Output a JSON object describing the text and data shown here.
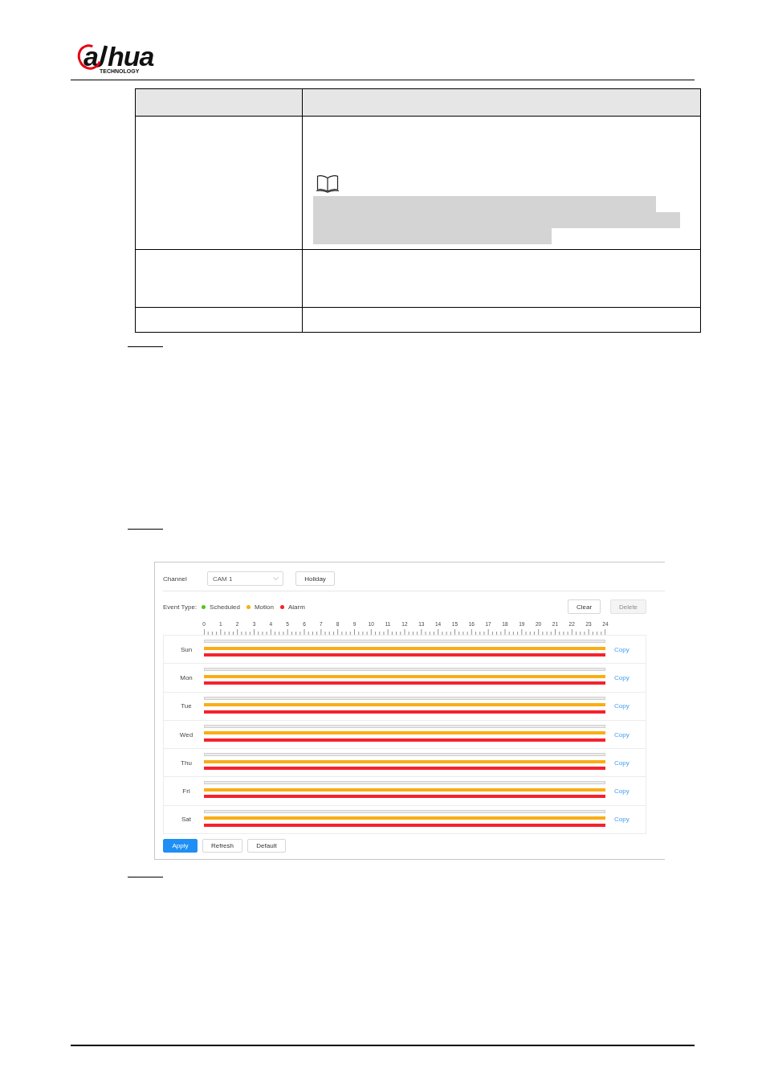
{
  "logo": {
    "mark": "a",
    "name": "hua",
    "tagline": "TECHNOLOGY"
  },
  "table": {
    "rows": [
      {
        "kind": "header"
      },
      {
        "kind": "note",
        "note": {
          "lines": [
            {
              "kind": "redacted"
            },
            {
              "kind": "redacted"
            },
            {
              "kind": "redacted"
            }
          ]
        }
      },
      {
        "kind": "blank"
      },
      {
        "kind": "blank"
      }
    ]
  },
  "schedule": {
    "channel": {
      "label": "Channel",
      "value": "CAM 1"
    },
    "holiday_button": "Holiday",
    "event_type_label": "Event Type:",
    "event_types": [
      {
        "name": "Scheduled",
        "color": "#52c41a"
      },
      {
        "name": "Motion",
        "color": "#faad14"
      },
      {
        "name": "Alarm",
        "color": "#f5222d"
      }
    ],
    "clear_button": "Clear",
    "delete_button": {
      "label": "Delete",
      "disabled": true
    },
    "hours": [
      "0",
      "1",
      "2",
      "3",
      "4",
      "5",
      "6",
      "7",
      "8",
      "9",
      "10",
      "11",
      "12",
      "13",
      "14",
      "15",
      "16",
      "17",
      "18",
      "19",
      "20",
      "21",
      "22",
      "23",
      "24"
    ],
    "days": [
      {
        "name": "Sun",
        "tracks": [
          {
            "filled": false
          },
          {
            "filled": true
          },
          {
            "filled": true
          }
        ],
        "copy": "Copy"
      },
      {
        "name": "Mon",
        "tracks": [
          {
            "filled": false
          },
          {
            "filled": true
          },
          {
            "filled": true
          }
        ],
        "copy": "Copy"
      },
      {
        "name": "Tue",
        "tracks": [
          {
            "filled": false
          },
          {
            "filled": true
          },
          {
            "filled": true
          }
        ],
        "copy": "Copy"
      },
      {
        "name": "Wed",
        "tracks": [
          {
            "filled": false
          },
          {
            "filled": true
          },
          {
            "filled": true
          }
        ],
        "copy": "Copy"
      },
      {
        "name": "Thu",
        "tracks": [
          {
            "filled": false
          },
          {
            "filled": true
          },
          {
            "filled": true
          }
        ],
        "copy": "Copy"
      },
      {
        "name": "Fri",
        "tracks": [
          {
            "filled": false
          },
          {
            "filled": true
          },
          {
            "filled": true
          }
        ],
        "copy": "Copy"
      },
      {
        "name": "Sat",
        "tracks": [
          {
            "filled": false
          },
          {
            "filled": true
          },
          {
            "filled": true
          }
        ],
        "copy": "Copy"
      }
    ],
    "buttons": [
      {
        "label": "Apply",
        "kind": "primary"
      },
      {
        "label": "Refresh",
        "kind": "default"
      },
      {
        "label": "Default",
        "kind": "default"
      }
    ]
  }
}
